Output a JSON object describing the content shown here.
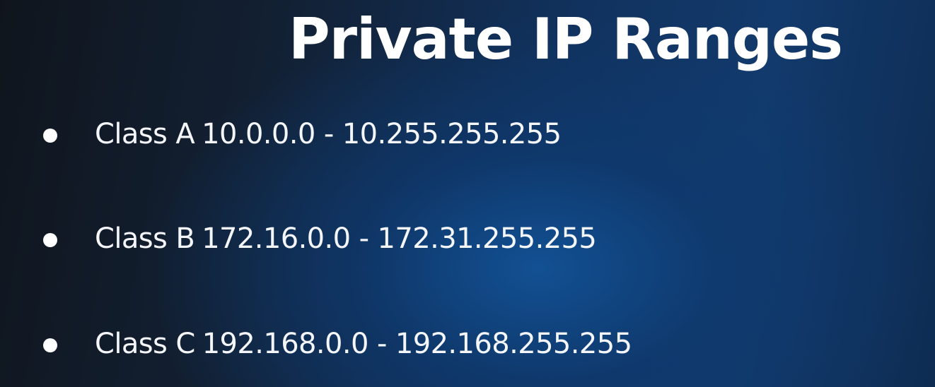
{
  "slide": {
    "title": "Private IP Ranges",
    "items": [
      {
        "class_label": "Class A",
        "range": "10.0.0.0 - 10.255.255.255"
      },
      {
        "class_label": "Class B",
        "range": "172.16.0.0 - 172.31.255.255"
      },
      {
        "class_label": "Class C",
        "range": "192.168.0.0 - 192.168.255.255"
      }
    ]
  },
  "colors": {
    "background_dark": "#10151d",
    "background_blue": "#12528f",
    "text": "#ffffff"
  }
}
